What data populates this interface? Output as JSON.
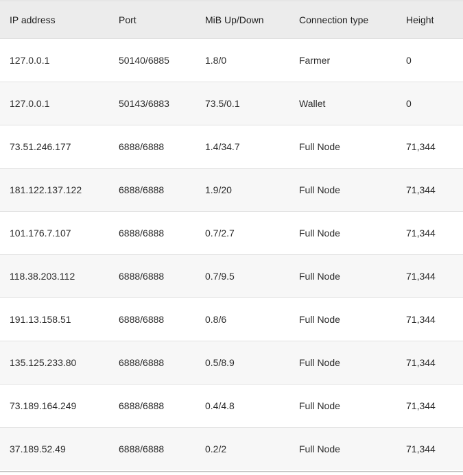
{
  "table": {
    "headers": [
      "IP address",
      "Port",
      "MiB Up/Down",
      "Connection type",
      "Height"
    ],
    "rows": [
      [
        "127.0.0.1",
        "50140/6885",
        "1.8/0",
        "Farmer",
        "0"
      ],
      [
        "127.0.0.1",
        "50143/6883",
        "73.5/0.1",
        "Wallet",
        "0"
      ],
      [
        "73.51.246.177",
        "6888/6888",
        "1.4/34.7",
        "Full Node",
        "71,344"
      ],
      [
        "181.122.137.122",
        "6888/6888",
        "1.9/20",
        "Full Node",
        "71,344"
      ],
      [
        "101.176.7.107",
        "6888/6888",
        "0.7/2.7",
        "Full Node",
        "71,344"
      ],
      [
        "118.38.203.112",
        "6888/6888",
        "0.7/9.5",
        "Full Node",
        "71,344"
      ],
      [
        "191.13.158.51",
        "6888/6888",
        "0.8/6",
        "Full Node",
        "71,344"
      ],
      [
        "135.125.233.80",
        "6888/6888",
        "0.5/8.9",
        "Full Node",
        "71,344"
      ],
      [
        "73.189.164.249",
        "6888/6888",
        "0.4/4.8",
        "Full Node",
        "71,344"
      ],
      [
        "37.189.52.49",
        "6888/6888",
        "0.2/2",
        "Full Node",
        "71,344"
      ]
    ]
  },
  "colors": {
    "header_bg": "#ececec",
    "row_alt_bg": "#f7f7f7",
    "text": "#2b2b2b"
  }
}
